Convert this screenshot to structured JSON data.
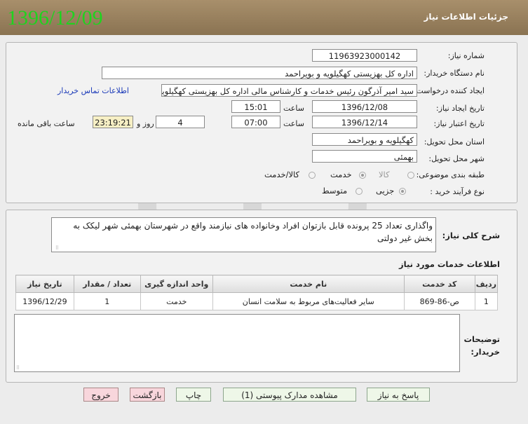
{
  "header": {
    "title": "جزئیات اطلاعات نیاز",
    "date_stamp": "1396/12/09"
  },
  "form": {
    "need_number_label": "شماره نیاز:",
    "need_number": "11963923000142",
    "buyer_org_label": "نام دستگاه خریدار:",
    "buyer_org": "اداره کل بهزیستی کهگیلویه و بویراحمد",
    "requester_label": "ایجاد کننده درخواست:",
    "requester": "سید امیر آذرگون رئیس خدمات و کارشناس مالی اداره کل بهزیستی کهگیلویه و",
    "contact_link": "اطلاعات تماس خریدار",
    "created_label": "تاریخ ایجاد نیاز:",
    "created_date": "1396/12/08",
    "time_label": "ساعت",
    "created_time": "15:01",
    "valid_label": "تاریخ اعتبار نیاز:",
    "valid_date": "1396/12/14",
    "valid_time": "07:00",
    "days_label": "روز و",
    "days_value": "4",
    "remaining_time": "23:19:21",
    "remaining_label": "ساعت باقی مانده",
    "province_label": "استان محل تحویل:",
    "province": "کهگیلویه و بویراحمد",
    "city_label": "شهر محل تحویل:",
    "city": "بهمئی",
    "category_label": "طبقه بندی موضوعی:",
    "category_options": [
      "کالا",
      "خدمت",
      "کالا/خدمت"
    ],
    "category_selected": "خدمت",
    "process_label": "نوع فرآیند خرید :",
    "process_options": [
      "جزیی",
      "متوسط"
    ],
    "process_selected": "جزیی"
  },
  "description": {
    "label": "شرح کلی نیاز:",
    "text": "واگذاری تعداد 25 پرونده قابل بازتوان افراد وخانواده های نیازمند واقع در شهرستان بهمئی شهر لیکک به بخش غیر دولتی"
  },
  "services": {
    "title": "اطلاعات خدمات مورد نیاز",
    "headers": [
      "ردیف",
      "کد خدمت",
      "نام خدمت",
      "واحد اندازه گیری",
      "تعداد / مقدار",
      "تاریخ نیاز"
    ],
    "rows": [
      [
        "1",
        "ص-86-869",
        "سایر فعالیت‌های مربوط به سلامت انسان",
        "خدمت",
        "1",
        "1396/12/29"
      ]
    ]
  },
  "notes": {
    "label_line1": "توضیحات",
    "label_line2": "خریدار:",
    "text": ""
  },
  "buttons": {
    "reply": "پاسخ به نیاز",
    "attachments": "مشاهده مدارک پیوستی (1)",
    "print": "چاپ",
    "back": "بازگشت",
    "exit": "خروج"
  },
  "colors": {
    "header_bg": "#9a8260",
    "date_stamp": "#1fd31f",
    "link": "#1a39b8",
    "remaining_bg": "#f7f0c5",
    "pink_button": "#f8d6dc",
    "green_button": "#eef7e8"
  }
}
